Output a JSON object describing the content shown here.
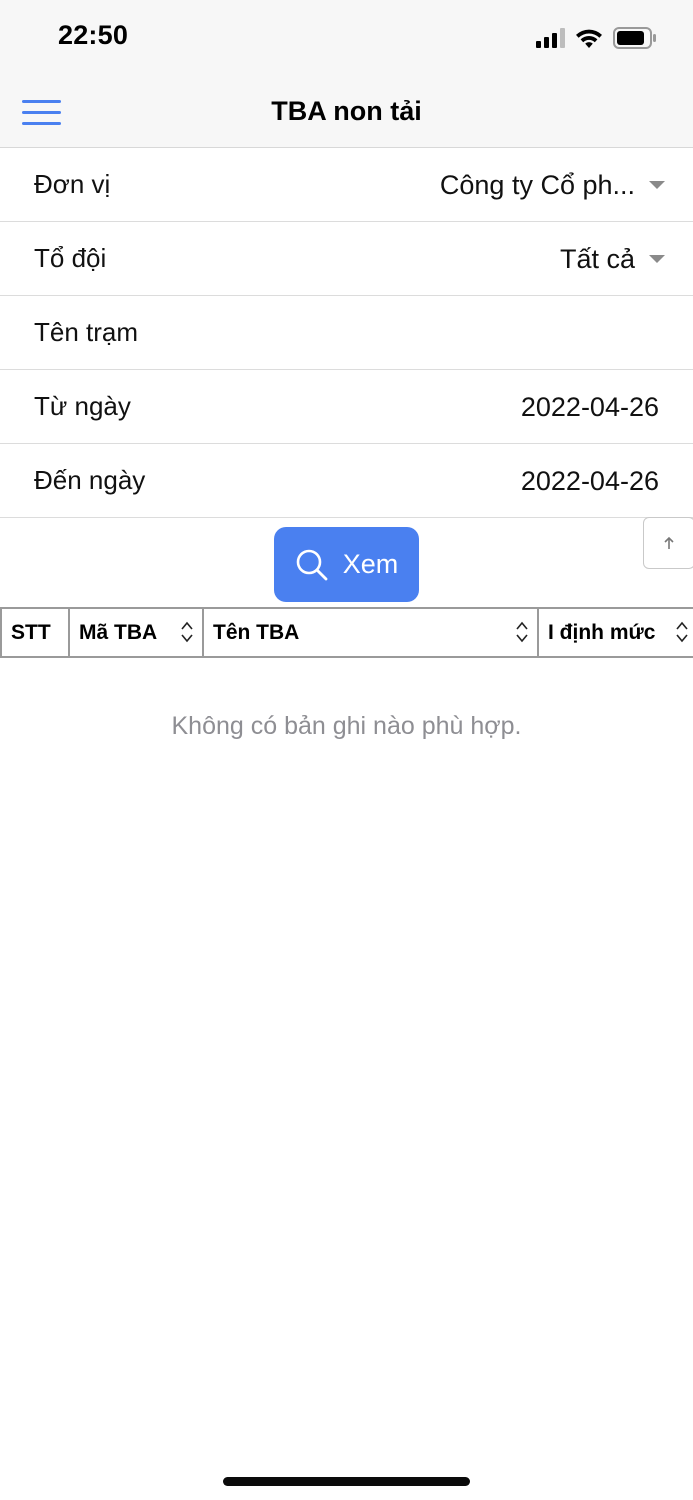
{
  "status_bar": {
    "time": "22:50"
  },
  "nav": {
    "title": "TBA non tải"
  },
  "form": {
    "don_vi": {
      "label": "Đơn vị",
      "value": "Công ty Cổ ph..."
    },
    "to_doi": {
      "label": "Tổ đội",
      "value": "Tất cả"
    },
    "ten_tram": {
      "label": "Tên trạm",
      "value": ""
    },
    "tu_ngay": {
      "label": "Từ ngày",
      "value": "2022-04-26"
    },
    "den_ngay": {
      "label": "Đến ngày",
      "value": "2022-04-26"
    }
  },
  "actions": {
    "view_label": "Xem"
  },
  "table": {
    "columns": [
      "STT",
      "Mã TBA",
      "Tên TBA",
      "I định mức"
    ],
    "empty_message": "Không có bản ghi nào phù hợp."
  },
  "colors": {
    "accent": "#4a80f0",
    "muted_text": "#8e8e93",
    "bar_background": "#f7f7f7"
  },
  "icons": {
    "menu": "hamburger-menu-icon",
    "search": "search-icon",
    "scroll_top": "arrow-up-icon",
    "sort": "sort-icon",
    "dropdown": "caret-down-icon"
  }
}
